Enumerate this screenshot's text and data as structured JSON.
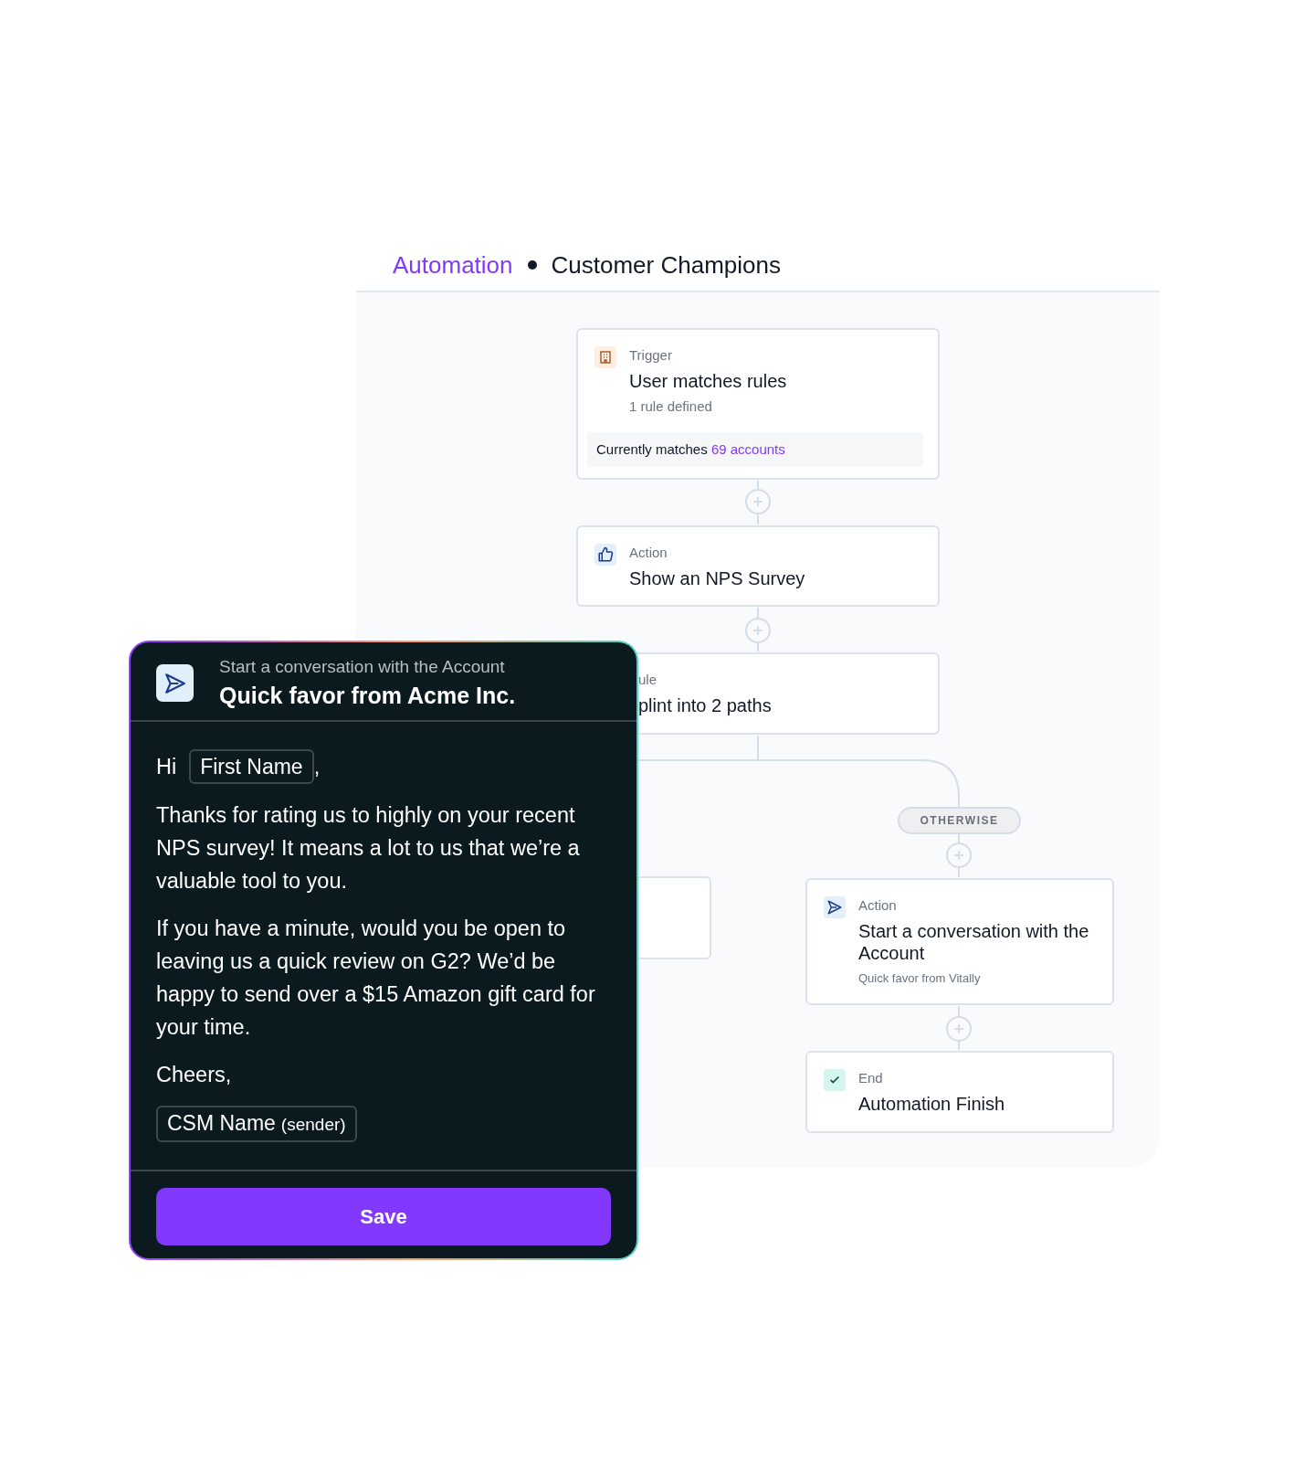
{
  "breadcrumb": {
    "section": "Automation",
    "title": "Customer Champions"
  },
  "flow": {
    "nodes": [
      {
        "kind": "trigger",
        "label": "Trigger",
        "title": "User matches rules",
        "subtitle": "1 rule defined",
        "footer": {
          "text": "Currently matches",
          "link": "69 accounts"
        }
      },
      {
        "kind": "survey",
        "label": "Action",
        "title": "Show an NPS Survey"
      },
      {
        "kind": "rule",
        "label": "ule",
        "title": "plint into 2 paths"
      },
      {
        "kind": "conversation",
        "label": "Action",
        "title": "Start a conversation with the Account",
        "subtitle": "Quick favor from Vitally"
      },
      {
        "kind": "end",
        "label": "End",
        "title": "Automation Finish"
      }
    ],
    "branch_label": "OTHERWISE"
  },
  "panel": {
    "subtitle": "Start a conversation with the Account",
    "title": "Quick favor from Acme Inc.",
    "greeting": "Hi",
    "first_name_token": "First Name",
    "greeting_end": ",",
    "paragraphs": [
      "Thanks for rating us to highly on your recent NPS survey! It means a lot to us that we’re a valuable tool to you.",
      "If you have a minute, would you be open to leaving us a quick review on G2? We’d be happy to send over a $15 Amazon gift card for your time."
    ],
    "closing": "Cheers,",
    "signature": {
      "name": "CSM Name",
      "note": "(sender)"
    },
    "button": "Save"
  }
}
